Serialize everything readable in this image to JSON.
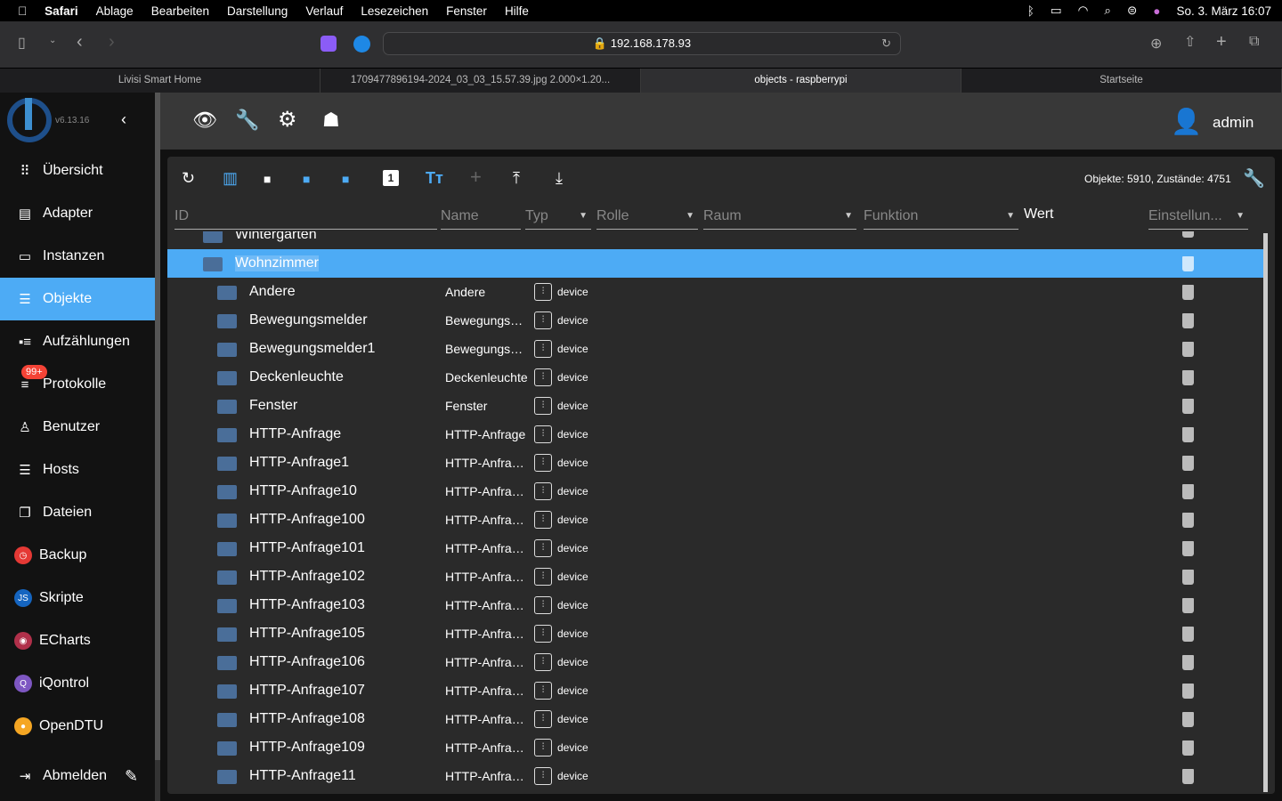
{
  "menubar": {
    "items": [
      "Safari",
      "Ablage",
      "Bearbeiten",
      "Darstellung",
      "Verlauf",
      "Lesezeichen",
      "Fenster",
      "Hilfe"
    ],
    "clock": "So. 3. März  16:07"
  },
  "browser": {
    "url": "192.168.178.93",
    "tabs": [
      "Livisi Smart Home",
      "1709477896194-2024_03_03_15.57.39.jpg 2.000×1.20...",
      "objects - raspberrypi",
      "Startseite"
    ],
    "active_tab": 2
  },
  "sidebar": {
    "version": "v6.13.16",
    "items": [
      {
        "label": "Übersicht",
        "icon": "grid-icon"
      },
      {
        "label": "Adapter",
        "icon": "store-icon"
      },
      {
        "label": "Instanzen",
        "icon": "instances-icon"
      },
      {
        "label": "Objekte",
        "icon": "list-icon",
        "active": true
      },
      {
        "label": "Aufzählungen",
        "icon": "enum-icon"
      },
      {
        "label": "Protokolle",
        "icon": "log-icon"
      },
      {
        "label": "Benutzer",
        "icon": "user-icon"
      },
      {
        "label": "Hosts",
        "icon": "hosts-icon"
      },
      {
        "label": "Dateien",
        "icon": "files-icon"
      },
      {
        "label": "Backup",
        "icon": "backup-icon",
        "color": "#e53935"
      },
      {
        "label": "Skripte",
        "icon": "js-icon",
        "color": "#1565c0"
      },
      {
        "label": "ECharts",
        "icon": "echarts-icon",
        "color": "#b0304a"
      },
      {
        "label": "iQontrol",
        "icon": "iqontrol-icon",
        "color": "#7e57c2"
      },
      {
        "label": "OpenDTU",
        "icon": "opendtu-icon",
        "color": "#f5a623"
      }
    ],
    "badge": "99+",
    "logout": "Abmelden"
  },
  "header": {
    "user": "admin"
  },
  "objects": {
    "stats": "Objekte: 5910, Zustände: 4751",
    "columns": {
      "id": "ID",
      "name": "Name",
      "type": "Typ",
      "role": "Rolle",
      "room": "Raum",
      "function": "Funktion",
      "value": "Wert",
      "settings": "Einstellun..."
    },
    "partial_row": "Wintergarten",
    "selected": "Wohnzimmer",
    "rows": [
      [
        "Andere",
        "Andere"
      ],
      [
        "Bewegungsmelder",
        "Bewegungsm..."
      ],
      [
        "Bewegungsmelder1",
        "Bewegungsm..."
      ],
      [
        "Deckenleuchte",
        "Deckenleuchte"
      ],
      [
        "Fenster",
        "Fenster"
      ],
      [
        "HTTP-Anfrage",
        "HTTP-Anfrage"
      ],
      [
        "HTTP-Anfrage1",
        "HTTP-Anfrage1"
      ],
      [
        "HTTP-Anfrage10",
        "HTTP-Anfrage..."
      ],
      [
        "HTTP-Anfrage100",
        "HTTP-Anfrage..."
      ],
      [
        "HTTP-Anfrage101",
        "HTTP-Anfrage..."
      ],
      [
        "HTTP-Anfrage102",
        "HTTP-Anfrage..."
      ],
      [
        "HTTP-Anfrage103",
        "HTTP-Anfrage..."
      ],
      [
        "HTTP-Anfrage105",
        "HTTP-Anfrage..."
      ],
      [
        "HTTP-Anfrage106",
        "HTTP-Anfrage..."
      ],
      [
        "HTTP-Anfrage107",
        "HTTP-Anfrage..."
      ],
      [
        "HTTP-Anfrage108",
        "HTTP-Anfrage..."
      ],
      [
        "HTTP-Anfrage109",
        "HTTP-Anfrage..."
      ],
      [
        "HTTP-Anfrage11",
        "HTTP-Anfrage..."
      ]
    ],
    "row_type": "device"
  },
  "colors": {
    "accent": "#4dabf5",
    "folder": "#4a6e99"
  }
}
